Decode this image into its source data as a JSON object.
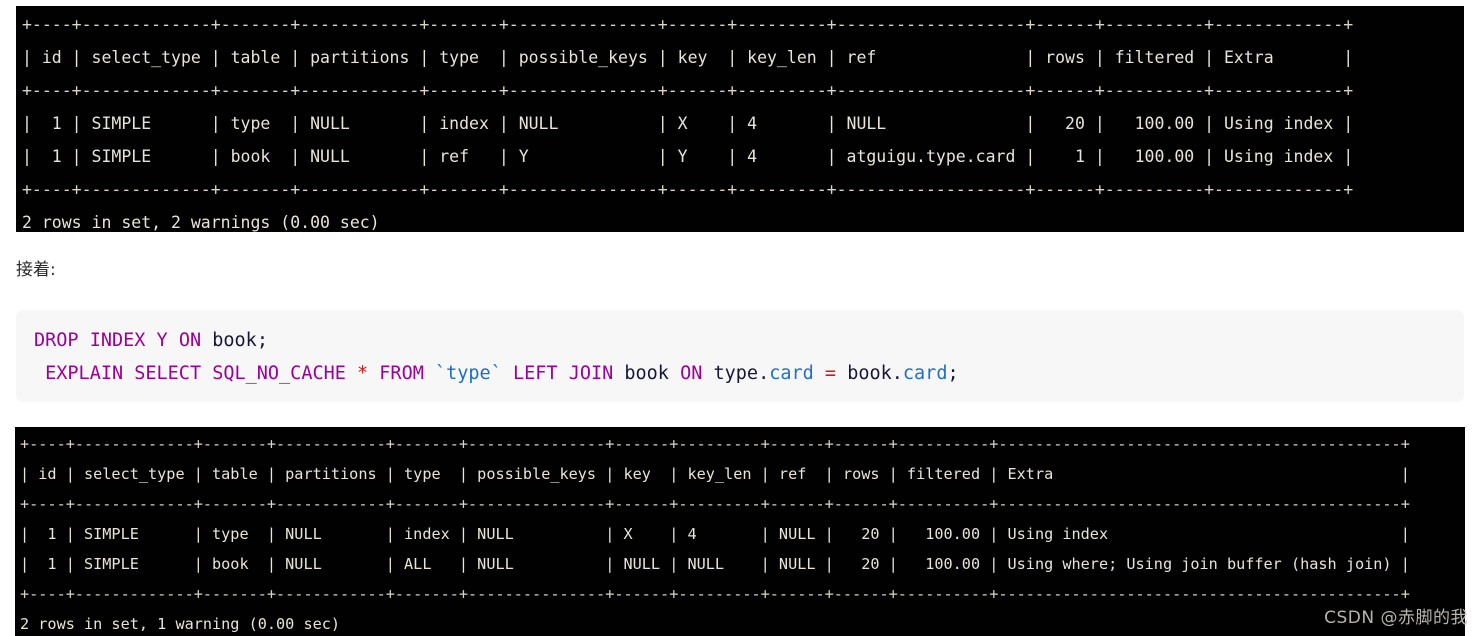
{
  "terminal_top": {
    "lines": [
      "+----+-------------+-------+------------+-------+---------------+------+---------+-------------------+------+----------+-------------+",
      "| id | select_type | table | partitions | type  | possible_keys | key  | key_len | ref               | rows | filtered | Extra       |",
      "+----+-------------+-------+------------+-------+---------------+------+---------+-------------------+------+----------+-------------+",
      "|  1 | SIMPLE      | type  | NULL       | index | NULL          | X    | 4       | NULL              |   20 |   100.00 | Using index |",
      "|  1 | SIMPLE      | book  | NULL       | ref   | Y             | Y    | 4       | atguigu.type.card |    1 |   100.00 | Using index |",
      "+----+-------------+-------+------------+-------+---------------+------+---------+-------------------+------+----------+-------------+",
      "2 rows in set, 2 warnings (0.00 sec)"
    ],
    "columns": [
      "id",
      "select_type",
      "table",
      "partitions",
      "type",
      "possible_keys",
      "key",
      "key_len",
      "ref",
      "rows",
      "filtered",
      "Extra"
    ],
    "rows": [
      [
        "1",
        "SIMPLE",
        "type",
        "NULL",
        "index",
        "NULL",
        "X",
        "4",
        "NULL",
        "20",
        "100.00",
        "Using index"
      ],
      [
        "1",
        "SIMPLE",
        "book",
        "NULL",
        "ref",
        "Y",
        "Y",
        "4",
        "atguigu.type.card",
        "1",
        "100.00",
        "Using index"
      ]
    ],
    "status": "2 rows in set, 2 warnings (0.00 sec)"
  },
  "prose": {
    "note": "接着:"
  },
  "code": {
    "line1": {
      "kw_drop": "DROP",
      "kw_index": "INDEX",
      "name_y": "Y",
      "kw_on": "ON",
      "table_book": "book",
      "semicolon": ";"
    },
    "line2": {
      "kw_explain": "EXPLAIN",
      "kw_select": "SELECT",
      "kw_nocache": "SQL_NO_CACHE",
      "star": "*",
      "kw_from": "FROM",
      "backtick_open": "`",
      "table_type": "type",
      "backtick_close": "`",
      "kw_left": "LEFT",
      "kw_join": "JOIN",
      "table_book": "book",
      "kw_on": "ON",
      "left_tbl": "type",
      "left_dot": ".",
      "left_col": "card",
      "eq": "=",
      "right_tbl": "book",
      "right_dot": ".",
      "right_col": "card",
      "semicolon": ";"
    }
  },
  "terminal_bottom": {
    "lines": [
      "+----+-------------+-------+------------+-------+---------------+------+---------+------+------+----------+--------------------------------------------+",
      "| id | select_type | table | partitions | type  | possible_keys | key  | key_len | ref  | rows | filtered | Extra                                      |",
      "+----+-------------+-------+------------+-------+---------------+------+---------+------+------+----------+--------------------------------------------+",
      "|  1 | SIMPLE      | type  | NULL       | index | NULL          | X    | 4       | NULL |   20 |   100.00 | Using index                                |",
      "|  1 | SIMPLE      | book  | NULL       | ALL   | NULL          | NULL | NULL    | NULL |   20 |   100.00 | Using where; Using join buffer (hash join) |",
      "+----+-------------+-------+------------+-------+---------------+------+---------+------+------+----------+--------------------------------------------+",
      "2 rows in set, 1 warning (0.00 sec)"
    ],
    "columns": [
      "id",
      "select_type",
      "table",
      "partitions",
      "type",
      "possible_keys",
      "key",
      "key_len",
      "ref",
      "rows",
      "filtered",
      "Extra"
    ],
    "rows": [
      [
        "1",
        "SIMPLE",
        "type",
        "NULL",
        "index",
        "NULL",
        "X",
        "4",
        "NULL",
        "20",
        "100.00",
        "Using index"
      ],
      [
        "1",
        "SIMPLE",
        "book",
        "NULL",
        "ALL",
        "NULL",
        "NULL",
        "NULL",
        "NULL",
        "20",
        "100.00",
        "Using where; Using join buffer (hash join)"
      ]
    ],
    "status": "2 rows in set, 1 warning (0.00 sec)"
  },
  "watermark": {
    "text": "CSDN @赤脚的我"
  },
  "colors": {
    "terminal_bg": "#010101",
    "terminal_fg": "#e8e4d8",
    "code_bg": "#f7f7f7",
    "keyword": "#9b009b",
    "identifier": "#16163a",
    "quoted_table": "#1a6fc4",
    "operator": "#d01818",
    "watermark": "#b8b4ac"
  }
}
